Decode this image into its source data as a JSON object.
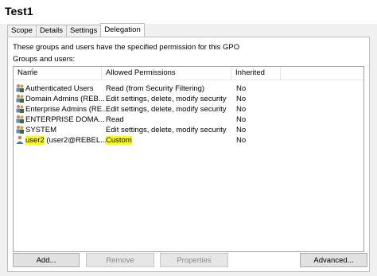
{
  "window": {
    "title": "Test1"
  },
  "tabs": [
    {
      "label": "Scope",
      "active": false
    },
    {
      "label": "Details",
      "active": false
    },
    {
      "label": "Settings",
      "active": false
    },
    {
      "label": "Delegation",
      "active": true
    }
  ],
  "delegation": {
    "description": "These groups and users have the specified permission for this GPO",
    "groups_label": "Groups and users:",
    "columns": [
      "Name",
      "Allowed Permissions",
      "Inherited"
    ],
    "sort_indicator": "^",
    "rows": [
      {
        "icon": "group-icon",
        "name": "Authenticated Users",
        "permission": "Read (from Security Filtering)",
        "inherited": "No",
        "highlighted": false
      },
      {
        "icon": "group-icon",
        "name": "Domain Admins (REB...",
        "permission": "Edit settings, delete, modify security",
        "inherited": "No",
        "highlighted": false
      },
      {
        "icon": "group-icon",
        "name": "Enterprise Admins (RE...",
        "permission": "Edit settings, delete, modify security",
        "inherited": "No",
        "highlighted": false
      },
      {
        "icon": "group-icon",
        "name": "ENTERPRISE DOMA...",
        "permission": "Read",
        "inherited": "No",
        "highlighted": false
      },
      {
        "icon": "group-icon",
        "name": "SYSTEM",
        "permission": "Edit settings, delete, modify security",
        "inherited": "No",
        "highlighted": false
      },
      {
        "icon": "user-icon",
        "name_highlight": "user2",
        "name_rest": " (user2@REBEL...",
        "permission": "Custom",
        "inherited": "No",
        "highlighted": true
      }
    ]
  },
  "buttons": {
    "add": "Add...",
    "remove": "Remove",
    "properties": "Properties",
    "advanced": "Advanced..."
  },
  "colors": {
    "highlight": "#ffff00",
    "panel_bg": "#ffffff",
    "window_bg": "#f0f0f0"
  }
}
